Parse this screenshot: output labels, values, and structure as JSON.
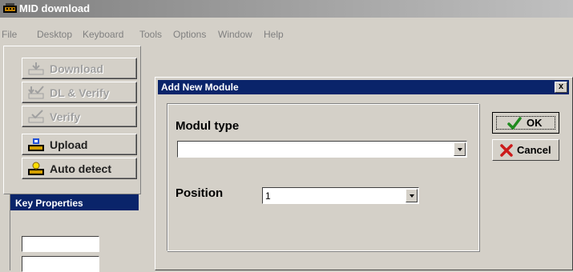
{
  "window": {
    "title": "MID download"
  },
  "menu": [
    "File",
    "Desktop",
    "Keyboard",
    "Tools",
    "Options",
    "Window",
    "Help"
  ],
  "toolbar": {
    "buttons": [
      {
        "label": "Download",
        "enabled": false,
        "icon": "download-icon"
      },
      {
        "label": "DL & Verify",
        "enabled": false,
        "icon": "dl-verify-icon"
      },
      {
        "label": "Verify",
        "enabled": false,
        "icon": "verify-icon"
      },
      {
        "label": "Upload",
        "enabled": true,
        "icon": "upload-icon"
      },
      {
        "label": "Auto detect",
        "enabled": true,
        "icon": "auto-detect-icon"
      }
    ]
  },
  "key_properties": {
    "title": "Key Properties"
  },
  "dialog": {
    "title": "Add New Module",
    "close_label": "x",
    "modul_type_label": "Modul type",
    "modul_type_value": "",
    "position_label": "Position",
    "position_value": "1",
    "ok_label": "OK",
    "cancel_label": "Cancel",
    "colors": {
      "ok_check": "#1e8a1e",
      "cancel_x": "#cc1b1b",
      "title_bar": "#0a246a"
    }
  }
}
